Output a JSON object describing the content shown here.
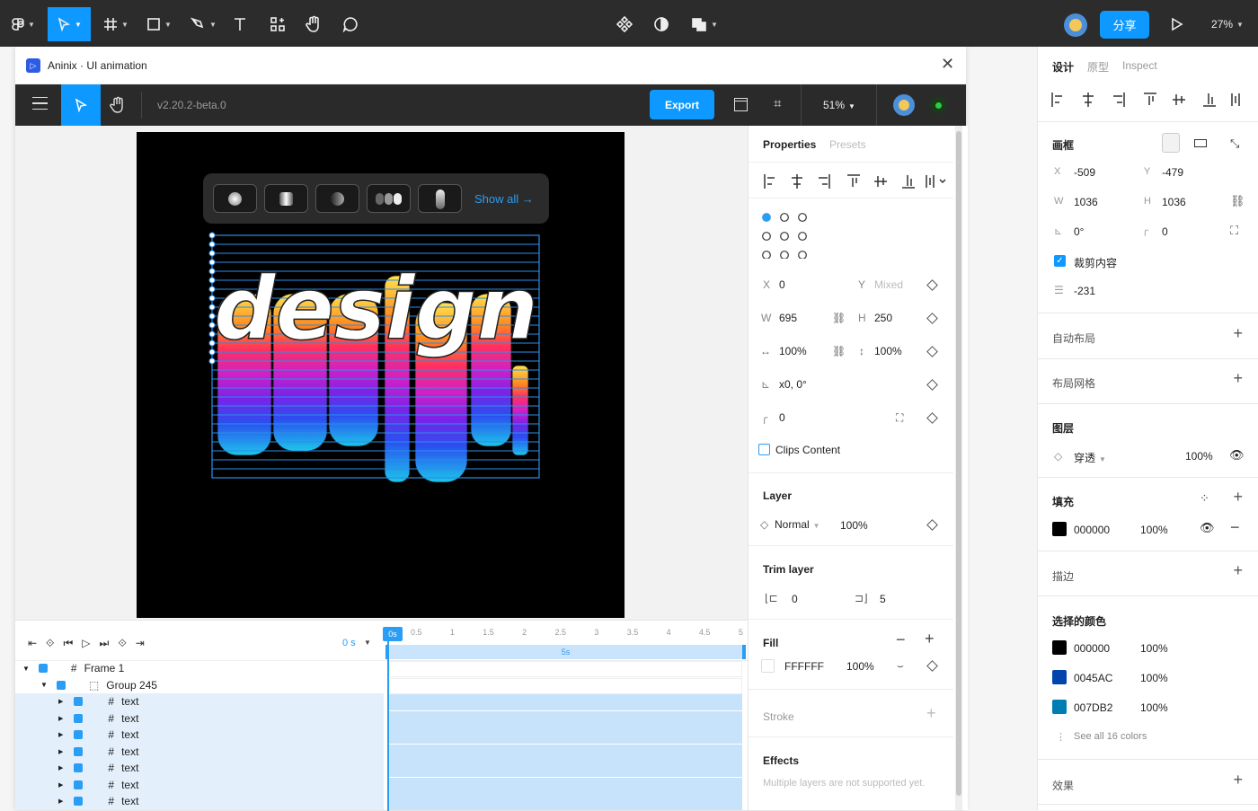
{
  "topbar": {
    "share": "分享",
    "zoom": "27%"
  },
  "plugin": {
    "title": "Aninix · UI animation",
    "version": "v2.20.2-beta.0",
    "export": "Export",
    "zoom": "51%",
    "show_all": "Show all →"
  },
  "props": {
    "tab_properties": "Properties",
    "tab_presets": "Presets",
    "x": "0",
    "y_label": "Y",
    "y": "Mixed",
    "x_label": "X",
    "w_label": "W",
    "w": "695",
    "h_label": "H",
    "h": "250",
    "sx": "100%",
    "sy": "100%",
    "skew": "x0, 0°",
    "radius": "0",
    "clips": "Clips Content",
    "layer_title": "Layer",
    "blend": "Normal",
    "opacity": "100%",
    "trim_title": "Trim layer",
    "trim_start": "0",
    "trim_end": "5",
    "fill_title": "Fill",
    "fill_hex": "FFFFFF",
    "fill_opacity": "100%",
    "stroke_title": "Stroke",
    "effects_title": "Effects",
    "effects_msg": "Multiple layers are not supported yet."
  },
  "timeline": {
    "time": "0 s",
    "cursor": "0s",
    "bar": "5s",
    "ticks": [
      "0.5",
      "1",
      "1.5",
      "2",
      "2.5",
      "3",
      "3.5",
      "4",
      "4.5",
      "5"
    ],
    "layers": [
      "Frame 1",
      "Group 245",
      "text",
      "text",
      "text",
      "text",
      "text",
      "text",
      "text"
    ]
  },
  "right": {
    "tab_design": "设计",
    "tab_proto": "原型",
    "tab_inspect": "Inspect",
    "frame": "画框",
    "x_label": "X",
    "x": "-509",
    "y_label": "Y",
    "y": "-479",
    "w_label": "W",
    "w": "1036",
    "h_label": "H",
    "h": "1036",
    "rot": "0°",
    "radius": "0",
    "clip": "裁剪内容",
    "spacing": "-231",
    "autolayout": "自动布局",
    "grid": "布局网格",
    "layer": "图层",
    "blend": "穿透",
    "layer_opacity": "100%",
    "fill": "填充",
    "fill_hex": "000000",
    "fill_opacity": "100%",
    "stroke": "描边",
    "selected_colors": "选择的颜色",
    "colors": [
      {
        "hex": "000000",
        "opacity": "100%",
        "color": "#000000"
      },
      {
        "hex": "0045AC",
        "opacity": "100%",
        "color": "#0045AC"
      },
      {
        "hex": "007DB2",
        "opacity": "100%",
        "color": "#007DB2"
      }
    ],
    "see_all": "See all 16 colors",
    "effects": "效果"
  },
  "colors": {
    "accent": "#0d99ff",
    "topbar": "#2c2c2c"
  }
}
